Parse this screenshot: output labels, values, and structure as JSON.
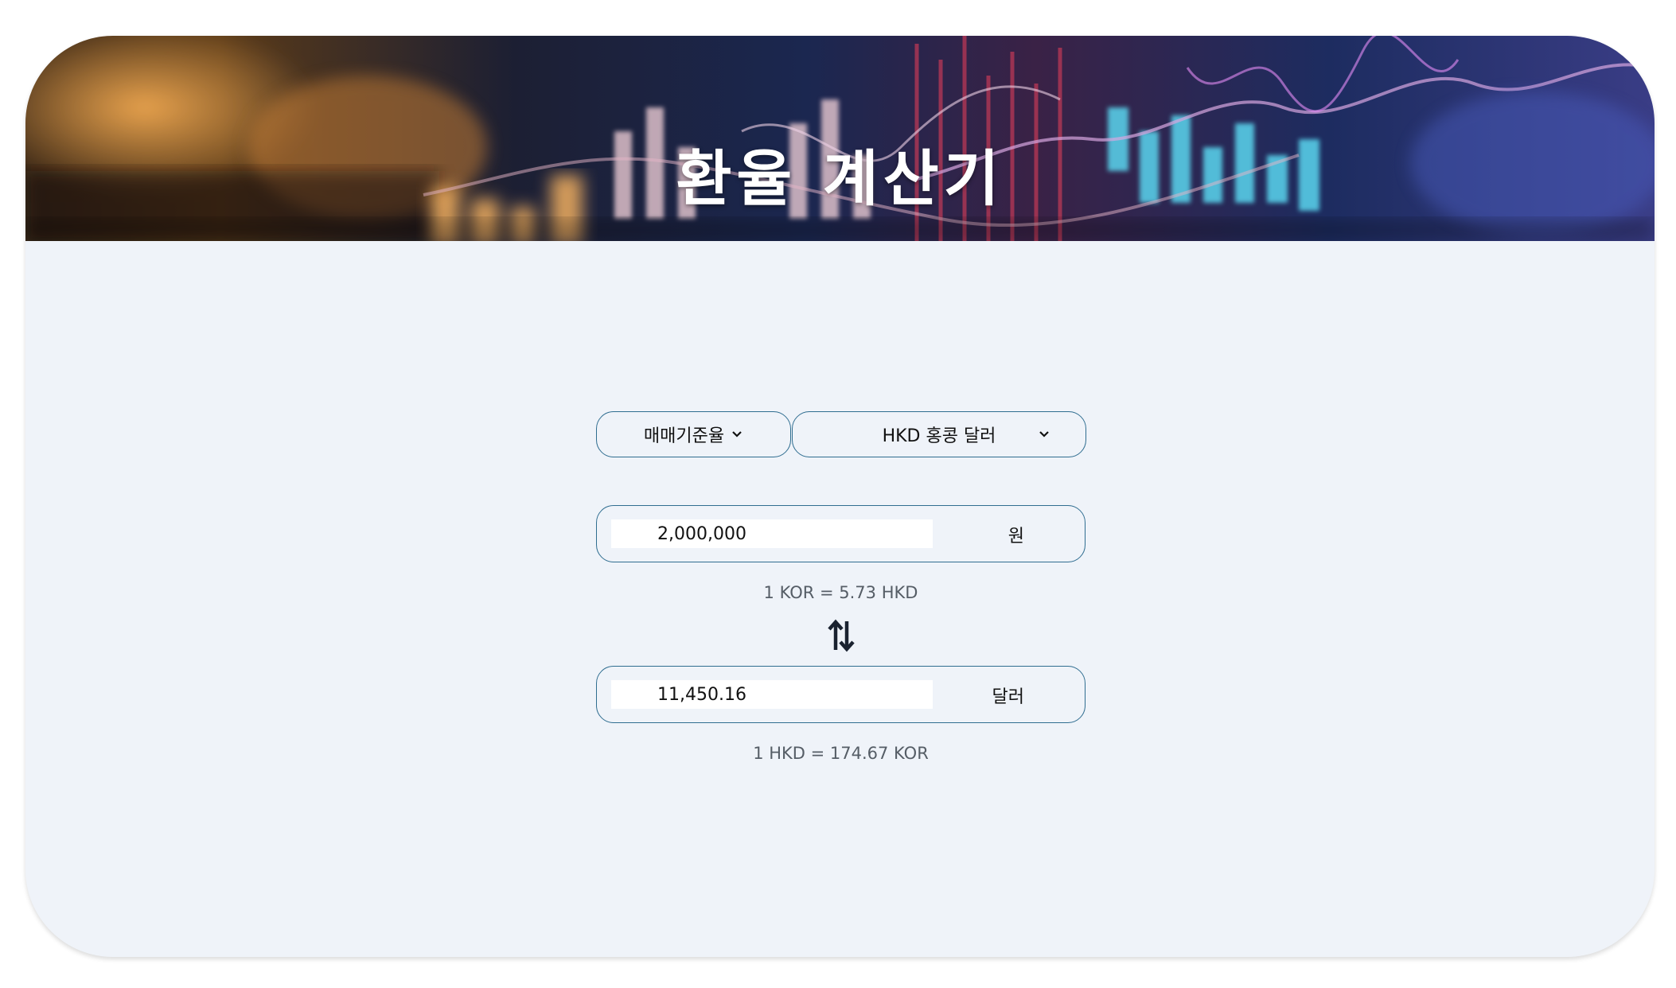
{
  "header": {
    "title": "환율 계산기"
  },
  "controls": {
    "rate_type": "매매기준율",
    "currency": "HKD 홍콩 달러"
  },
  "from": {
    "amount": "2,000,000",
    "unit": "원",
    "rate_text": "1 KOR = 5.73 HKD"
  },
  "to": {
    "amount": "11,450.16",
    "unit": "달러",
    "rate_text": "1 HKD = 174.67 KOR"
  },
  "icons": {
    "rate_dropdown": "chevron-down-icon",
    "currency_dropdown": "chevron-down-icon",
    "swap": "swap-arrows-icon"
  },
  "colors": {
    "background": "#eff3f9",
    "border": "#2f6d90",
    "muted_text": "#555d66"
  }
}
